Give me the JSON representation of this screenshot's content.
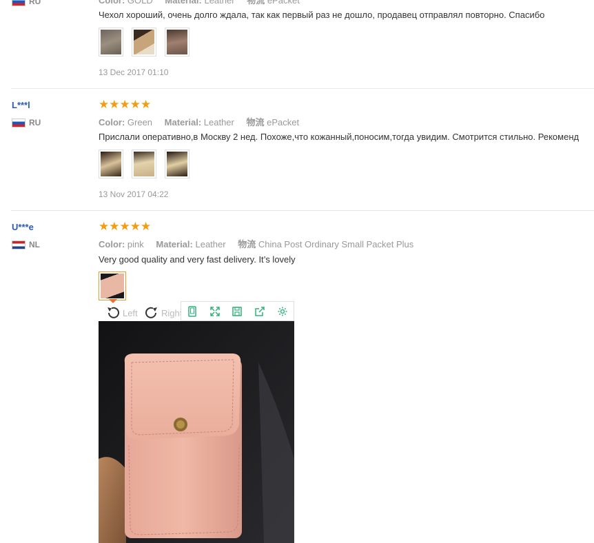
{
  "reviews": [
    {
      "user": "",
      "country": "RU",
      "color_label": "Color:",
      "color_value": "GOLD",
      "material_label": "Material:",
      "material_value": "Leather",
      "shipping_label": "物流",
      "shipping_value": "ePacket",
      "text": "Чехол хороший, очень долго ждала, так как первый раз не дошло, продавец отправлял повторно. Спасибо",
      "date": "13 Dec 2017 01:10"
    },
    {
      "user": "L***l",
      "country": "RU",
      "rating": 5,
      "stars": "★★★★★",
      "color_label": "Color:",
      "color_value": "Green",
      "material_label": "Material:",
      "material_value": "Leather",
      "shipping_label": "物流",
      "shipping_value": "ePacket",
      "text": "Прислали оперативно,в Москву 2 нед. Похоже,что кожанный,поносим,тогда увидим. Смотрится стильно. Рекоменд",
      "date": "13 Nov 2017 04:22"
    },
    {
      "user": "U***e",
      "country": "NL",
      "rating": 5,
      "stars": "★★★★★",
      "color_label": "Color:",
      "color_value": "pink",
      "material_label": "Material:",
      "material_value": "Leather",
      "shipping_label": "物流",
      "shipping_value": "China Post Ordinary Small Packet Plus",
      "text": "Very good quality and very fast delivery. It’s lovely"
    }
  ],
  "viewer": {
    "rotate_left": "Left",
    "rotate_right": "Right",
    "tools": [
      "phone-icon",
      "expand-icon",
      "save-icon",
      "share-icon",
      "settings-icon"
    ],
    "accent": "#2fb37a"
  },
  "colors": {
    "star": "#f39c12",
    "username": "#2a5bb0",
    "active_thumb": "#e89a2c"
  }
}
